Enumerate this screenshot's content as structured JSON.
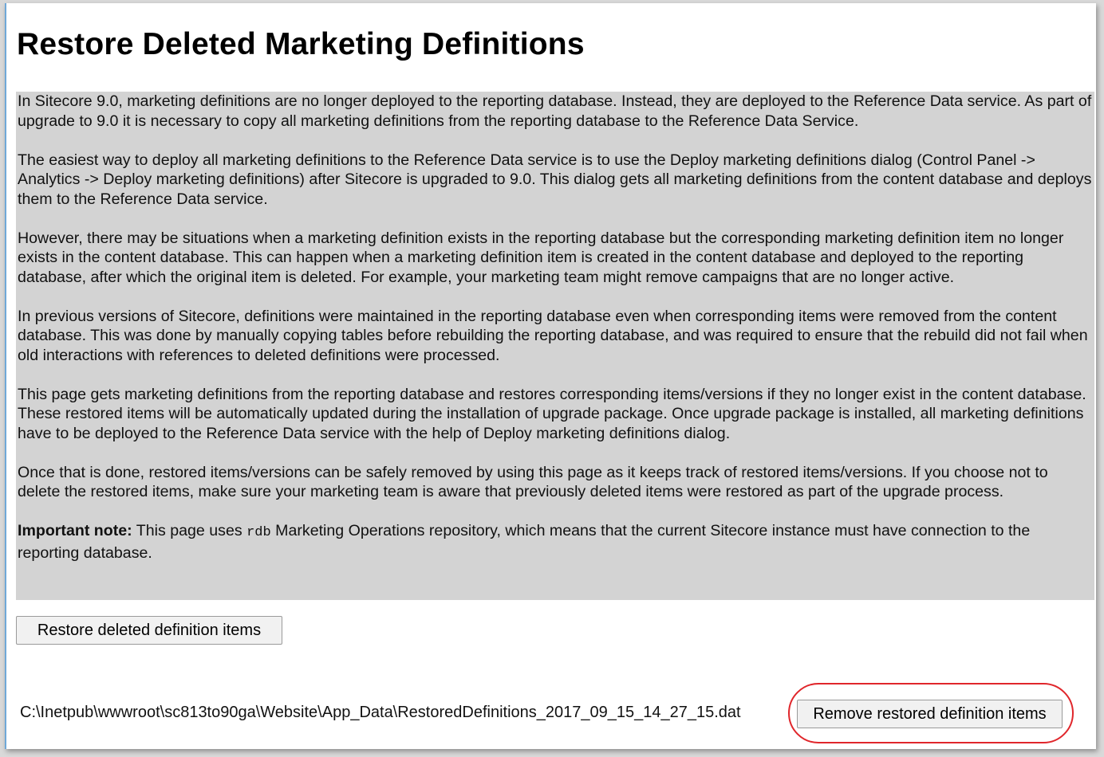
{
  "page": {
    "title": "Restore Deleted Marketing Definitions"
  },
  "info": {
    "p1": "In Sitecore 9.0, marketing definitions are no longer deployed to the reporting database. Instead, they are deployed to the Reference Data service. As part of upgrade to 9.0 it is necessary to copy all marketing definitions from the reporting database to the Reference Data Service.",
    "p2": "The easiest way to deploy all marketing definitions to the Reference Data service is to use the Deploy marketing definitions dialog (Control Panel -> Analytics -> Deploy marketing definitions) after Sitecore is upgraded to 9.0. This dialog gets all marketing definitions from the content database and deploys them to the Reference Data service.",
    "p3": "However, there may be situations when a marketing definition exists in the reporting database but the corresponding marketing definition item no longer exists in the content database. This can happen when a marketing definition item is created in the content database and deployed to the reporting database, after which the original item is deleted. For example, your marketing team might remove campaigns that are no longer active.",
    "p4": "In previous versions of Sitecore, definitions were maintained in the reporting database even when corresponding items were removed from the content database. This was done by manually copying tables before rebuilding the reporting database, and was required to ensure that the rebuild did not fail when old interactions with references to deleted definitions were processed.",
    "p5": "This page gets marketing definitions from the reporting database and restores corresponding items/versions if they no longer exist in the content database. These restored items will be automatically updated during the installation of upgrade package. Once upgrade package is installed, all marketing definitions have to be deployed to the Reference Data service with the help of Deploy marketing definitions dialog.",
    "p6": "Once that is done, restored items/versions can be safely removed by using this page as it keeps track of restored items/versions. If you choose not to delete the restored items, make sure your marketing team is aware that previously deleted items were restored as part of the upgrade process.",
    "note_label": "Important note:",
    "note_pre": " This page uses ",
    "note_code": "rdb",
    "note_post": " Marketing Operations repository, which means that the current Sitecore instance must have connection to the reporting database."
  },
  "actions": {
    "restore_label": "Restore deleted definition items",
    "file_path": "C:\\Inetpub\\wwwroot\\sc813to90ga\\Website\\App_Data\\RestoredDefinitions_2017_09_15_14_27_15.dat",
    "remove_label": "Remove restored definition items"
  },
  "colors": {
    "highlight": "#e0262b",
    "info_background": "#d3d3d3"
  }
}
